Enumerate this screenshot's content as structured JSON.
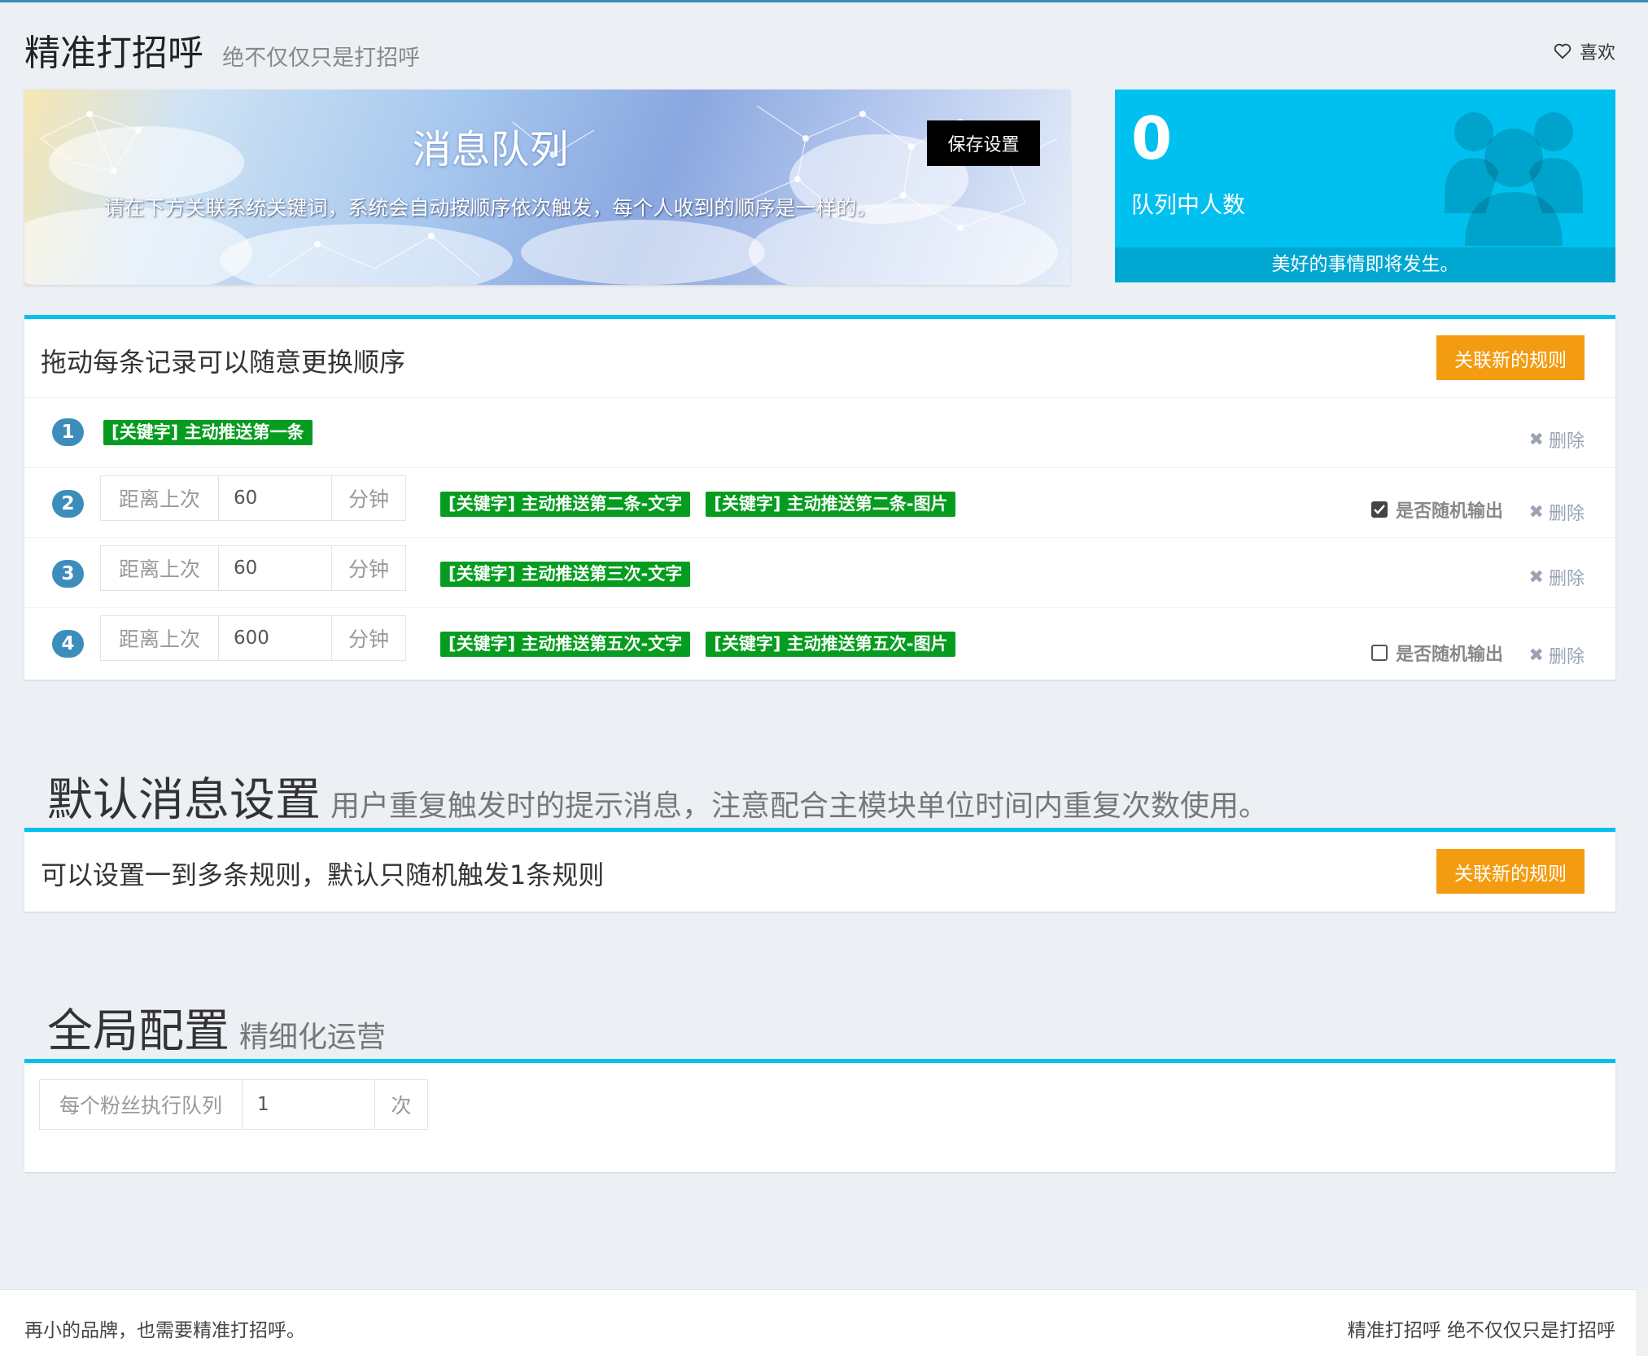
{
  "header": {
    "title": "精准打招呼",
    "subtitle": "绝不仅仅只是打招呼",
    "like_label": "喜欢"
  },
  "banner": {
    "title": "消息队列",
    "description": "请在下方关联系统关键词，系统会自动按顺序依次触发，每个人收到的顺序是一样的。",
    "save_label": "保存设置"
  },
  "stat": {
    "count": "0",
    "label": "队列中人数",
    "footer": "美好的事情即将发生。",
    "color": "#00c0ef"
  },
  "queue_box": {
    "title": "拖动每条记录可以随意更换顺序",
    "add_label": "关联新的规则",
    "rows": [
      {
        "num": "1",
        "tags": [
          "[关键字] 主动推送第一条"
        ],
        "delete_label": "删除"
      },
      {
        "num": "2",
        "prefix": "距离上次",
        "value": "60",
        "suffix": "分钟",
        "tags": [
          "[关键字] 主动推送第二条-文字",
          "[关键字] 主动推送第二条-图片"
        ],
        "random_label": "是否随机输出",
        "random_checked": true,
        "delete_label": "删除"
      },
      {
        "num": "3",
        "prefix": "距离上次",
        "value": "60",
        "suffix": "分钟",
        "tags": [
          "[关键字] 主动推送第三次-文字"
        ],
        "delete_label": "删除"
      },
      {
        "num": "4",
        "prefix": "距离上次",
        "value": "600",
        "suffix": "分钟",
        "tags": [
          "[关键字] 主动推送第五次-文字",
          "[关键字] 主动推送第五次-图片"
        ],
        "random_label": "是否随机输出",
        "random_checked": false,
        "delete_label": "删除"
      }
    ]
  },
  "default_section": {
    "title": "默认消息设置",
    "subtitle": "用户重复触发时的提示消息，注意配合主模块单位时间内重复次数使用。",
    "box_title": "可以设置一到多条规则，默认只随机触发1条规则",
    "add_label": "关联新的规则"
  },
  "global_section": {
    "title": "全局配置",
    "subtitle": "精细化运营",
    "field_label": "每个粉丝执行队列",
    "field_value": "1",
    "field_suffix": "次"
  },
  "footer": {
    "left": "再小的品牌，也需要精准打招呼。",
    "right": "精准打招呼 绝不仅仅只是打招呼"
  },
  "colors": {
    "accent": "#00c0ef",
    "orange": "#f39c12",
    "tag_green": "#069c1f",
    "badge_blue": "#3c8dbc"
  }
}
